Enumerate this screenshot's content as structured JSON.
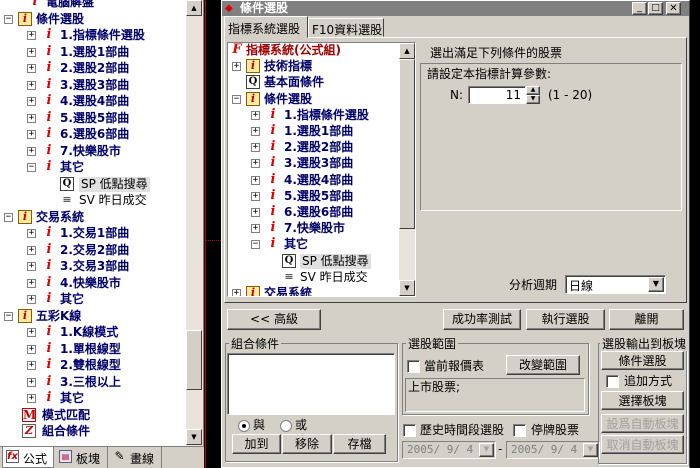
{
  "left_panel": {
    "top_item": "電腦解盤",
    "categories": [
      {
        "label": "條件選股",
        "items": [
          "1.指標條件選股",
          "1.選股1部曲",
          "2.選股2部曲",
          "3.選股3部曲",
          "4.選股4部曲",
          "5.選股5部曲",
          "6.選股6部曲",
          "7.快樂股市"
        ],
        "other": "其它",
        "other_children": [
          {
            "code": "SP",
            "label": "低點搜尋"
          },
          {
            "code": "SV",
            "label": "昨日成交"
          }
        ]
      },
      {
        "label": "交易系統",
        "items": [
          "1.交易1部曲",
          "2.交易2部曲",
          "3.交易3部曲",
          "4.快樂股市"
        ],
        "other": "其它"
      },
      {
        "label": "五彩K線",
        "items": [
          "1.K線模式",
          "1.單根線型",
          "2.雙根線型",
          "3.三根以上"
        ],
        "other": "其它"
      }
    ],
    "pattern_match": "模式匹配",
    "combo_condition": "組合條件",
    "tabs": [
      "公式",
      "板塊",
      "畫線"
    ]
  },
  "dialog": {
    "title": "條件選股",
    "tabs": [
      "指標系統選股",
      "F10資料選股"
    ],
    "tree": {
      "root": "指標系統(公式組)",
      "tech": "技術指標",
      "fundamental": "基本面條件",
      "cond": "條件選股",
      "items": [
        "1.指標條件選股",
        "1.選股1部曲",
        "2.選股2部曲",
        "3.選股3部曲",
        "4.選股4部曲",
        "5.選股5部曲",
        "6.選股6部曲",
        "7.快樂股市"
      ],
      "other": "其它",
      "sp": {
        "code": "SP",
        "label": "低點搜尋"
      },
      "sv": {
        "code": "SV",
        "label": "昨日成交"
      },
      "trade": "交易系統"
    },
    "desc_title": "選出滿足下列條件的股票",
    "param_prompt": "請設定本指標計算參數:",
    "param_name": "N:",
    "param_value": "11",
    "param_range": "(1 - 20)",
    "period_label": "分析週期",
    "period_value": "日線",
    "btn_advanced": "<< 高級",
    "btn_success": "成功率測試",
    "btn_run": "執行選股",
    "btn_leave": "離開",
    "combo": {
      "title": "組合條件",
      "and": "與",
      "or": "或",
      "add": "加到",
      "remove": "移除",
      "save": "存檔"
    },
    "range": {
      "title": "選股範圍",
      "current_report": "當前報價表",
      "change": "改變範圍",
      "list_text": "上市股票;"
    },
    "history": {
      "label": "歷史時間段選股",
      "suspended": "停牌股票",
      "date_from": "2005/ 9/ 4",
      "date_to": "2005/ 9/ 4",
      "dash": "-"
    },
    "output": {
      "title": "選股輸出到板塊",
      "btn_select": "條件選股",
      "append": "追加方式",
      "btn_board": "選擇板塊",
      "btn_set_auto": "設爲自動板塊",
      "btn_cancel_auto": "取消自動板塊"
    }
  }
}
